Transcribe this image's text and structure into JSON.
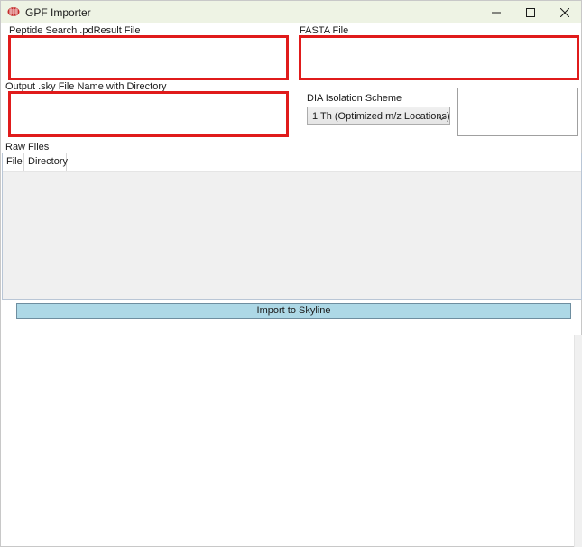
{
  "window": {
    "title": "GPF Importer",
    "icon": "app-icon"
  },
  "fields": {
    "peptide_label": "Peptide Search .pdResult File",
    "peptide_value": "",
    "fasta_label": "FASTA File",
    "fasta_value": "",
    "output_label": "Output .sky File Name with Directory",
    "output_value": "",
    "dia_label": "DIA Isolation Scheme",
    "dia_selected": "1 Th (Optimized m/z Locations)"
  },
  "raw_files": {
    "label": "Raw Files",
    "columns": [
      "File",
      "Directory"
    ],
    "rows": []
  },
  "import_button": "Import to Skyline",
  "colors": {
    "highlight_border": "#e01b1b",
    "button_bg": "#add8e6",
    "titlebar_bg": "#eef3e4"
  }
}
